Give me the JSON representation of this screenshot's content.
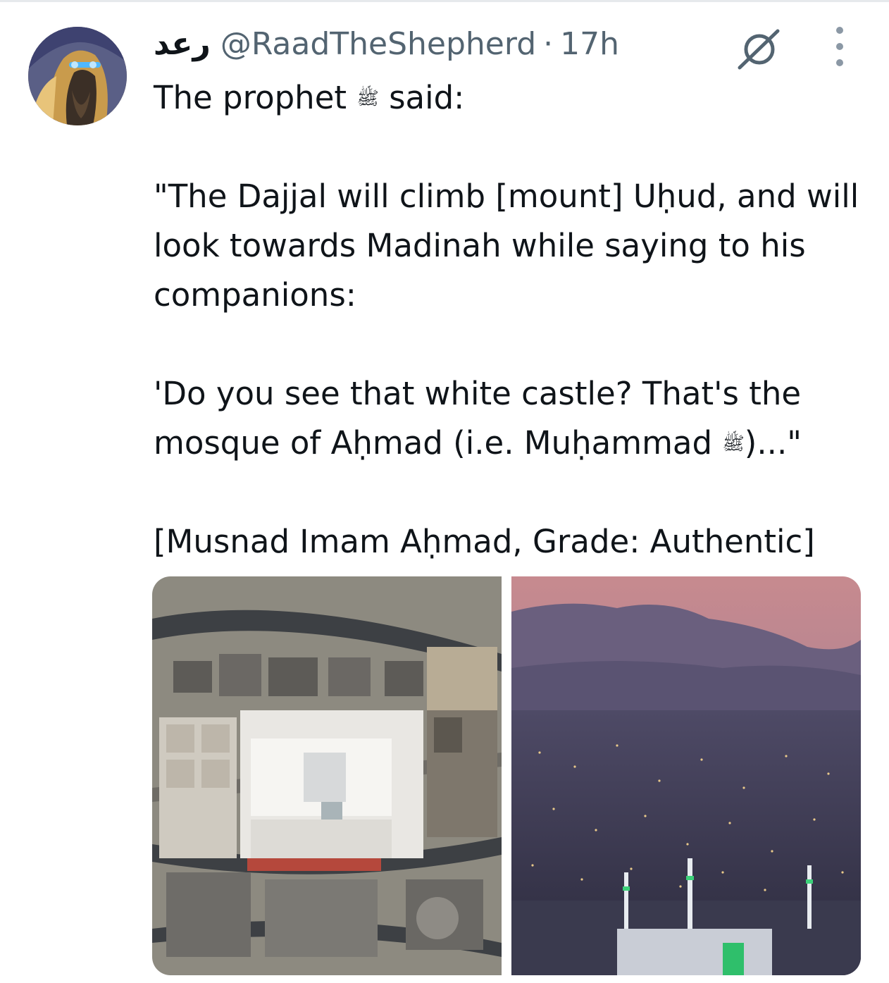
{
  "tweet": {
    "display_name": "رعد",
    "handle": "@RaadTheShepherd",
    "separator": "·",
    "timestamp": "17h",
    "intro_before": "The prophet",
    "honorific": "ﷺ",
    "intro_after": "said:",
    "paragraph_1": "\"The Dajjal will climb [mount] Uḥud, and will look towards Madinah while saying to his companions:",
    "paragraph_2_before": "'Do you see that white castle? That's the mosque of Aḥmad (i.e. Muḥammad",
    "paragraph_2_after": ")...\"",
    "citation": "[Musnad Imam Aḥmad, Grade: Authentic]"
  },
  "icons": {
    "avatar": "avatar-image",
    "grok": "grok-icon",
    "more": "more-options-icon"
  },
  "media": [
    {
      "name": "satellite-view-of-mosque-image"
    },
    {
      "name": "madinah-night-skyline-image"
    }
  ],
  "colors": {
    "text": "#0f1419",
    "secondary": "#536471",
    "divider": "#e6e9ec"
  }
}
